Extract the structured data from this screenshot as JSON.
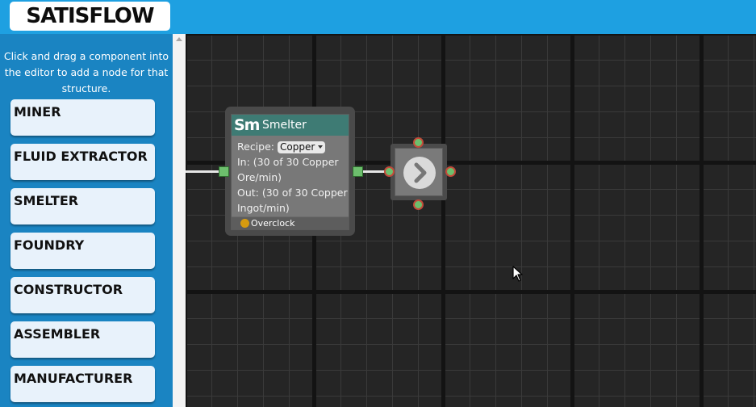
{
  "app": {
    "title": "SATISFLOW"
  },
  "sidebar": {
    "help_text": "Click and drag a component into the editor to add a node for that structure.",
    "components": [
      {
        "label": "MINER"
      },
      {
        "label": "FLUID EXTRACTOR"
      },
      {
        "label": "SMELTER"
      },
      {
        "label": "FOUNDRY"
      },
      {
        "label": "CONSTRUCTOR"
      },
      {
        "label": "ASSEMBLER"
      },
      {
        "label": "MANUFACTURER"
      }
    ]
  },
  "editor": {
    "node": {
      "abbr": "Sm",
      "title": "Smelter",
      "recipe_label": "Recipe:",
      "recipe_value": "Copper",
      "input_text": "In: (30 of 30 Copper Ore/min)",
      "output_text": "Out: (30 of 30 Copper Ingot/min)",
      "overclock_label": "Overclock"
    },
    "splitter": {
      "icon": "chevron-right-icon"
    }
  },
  "colors": {
    "header": "#1ea0e1",
    "sidebar": "#1a84c2",
    "node_header": "#3e7b74",
    "port": "#6dbf6d",
    "overclock": "#d69b10"
  }
}
